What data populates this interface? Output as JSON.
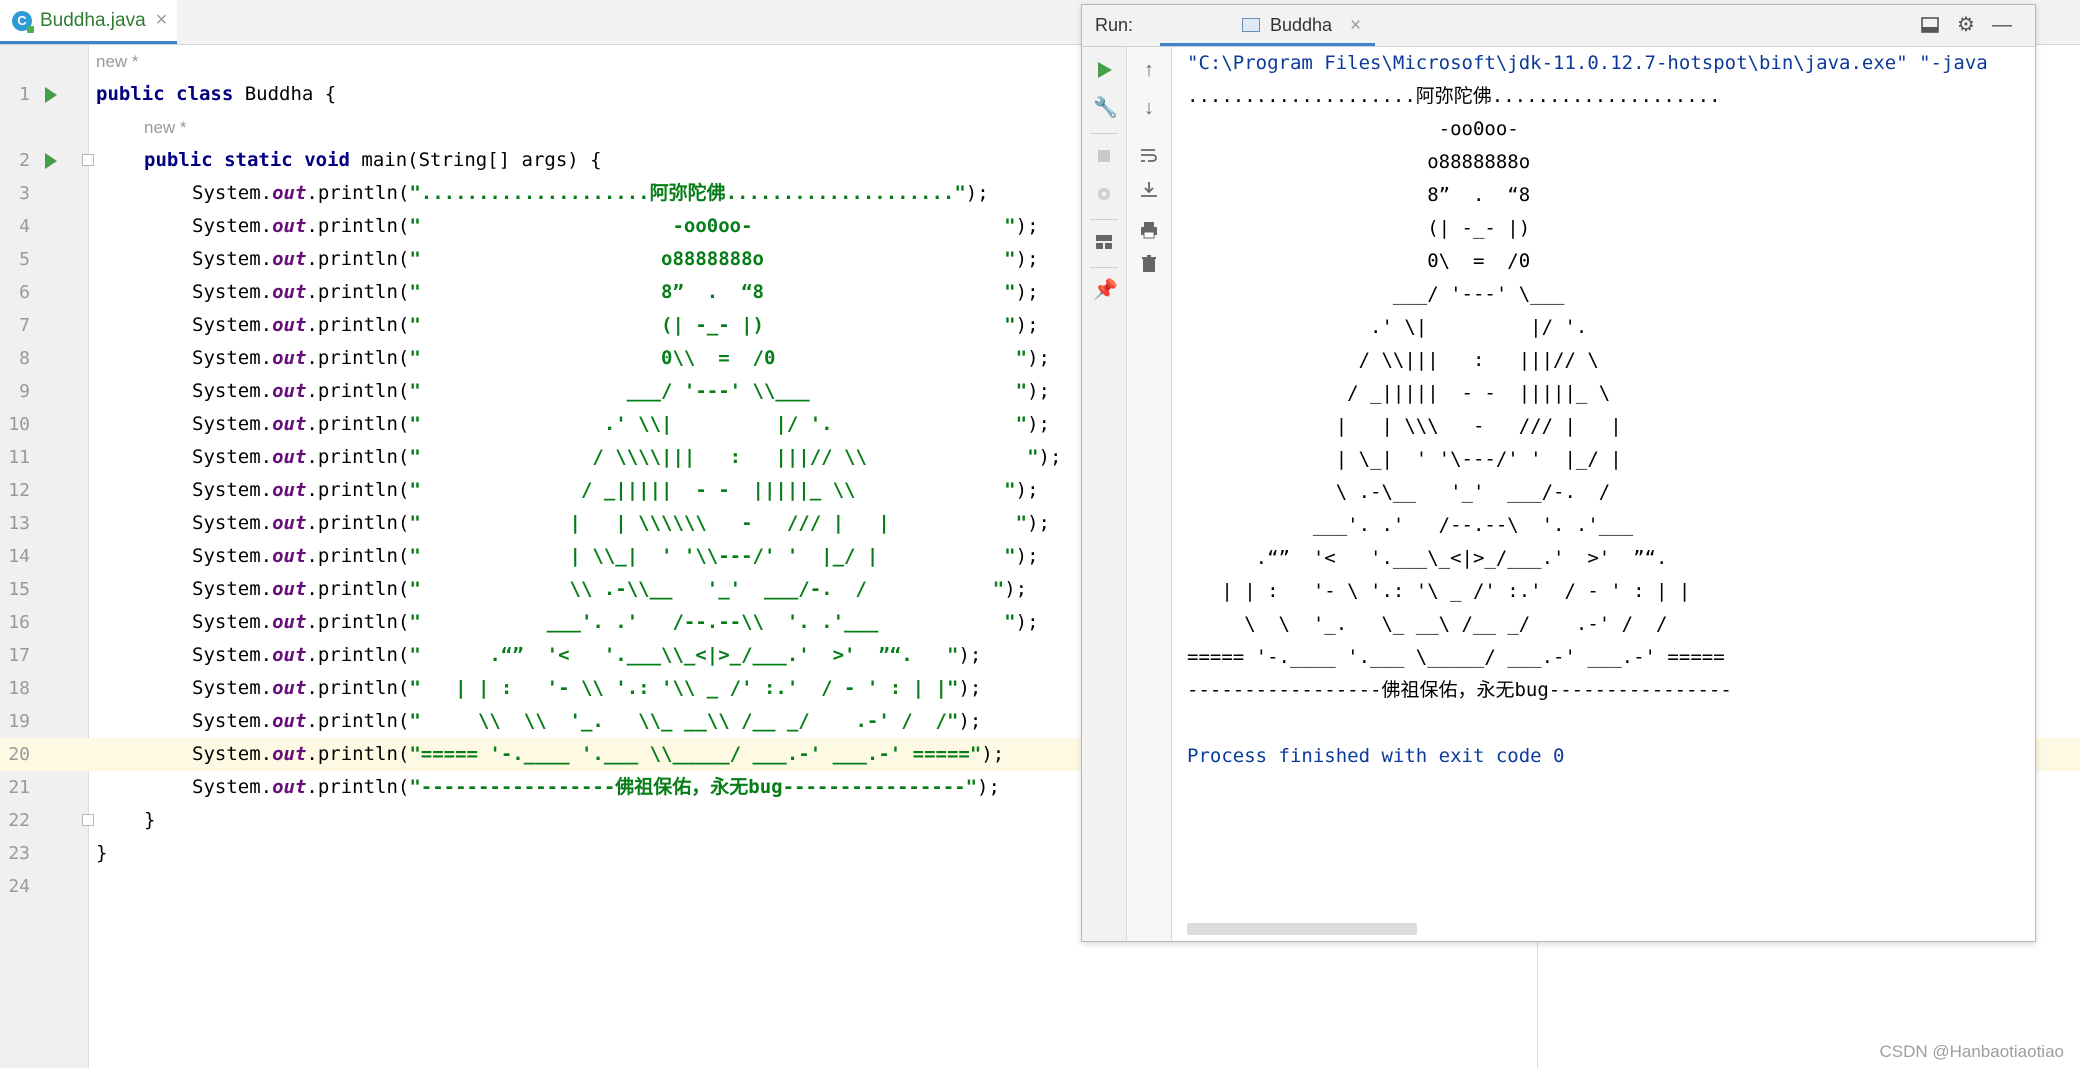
{
  "editor": {
    "tab_title": "Buddha.java",
    "file_icon_letter": "C",
    "tab_close": "×",
    "inlay_hint": "new *",
    "line_numbers": [
      "1",
      "2",
      "3",
      "4",
      "5",
      "6",
      "7",
      "8",
      "9",
      "10",
      "11",
      "12",
      "13",
      "14",
      "15",
      "16",
      "17",
      "18",
      "19",
      "20",
      "21",
      "22",
      "23",
      "24"
    ],
    "code": {
      "line1": [
        "public",
        " ",
        "class",
        " Buddha {"
      ],
      "line2": [
        "public",
        " ",
        "static",
        " ",
        "void",
        " main(String[] args) {"
      ],
      "sys": "System.",
      "out": "out",
      "println": ".println(",
      "end": ");",
      "strings": [
        "\"....................阿弥陀佛....................\"",
        "\"                      -oo0oo-                      \"",
        "\"                     o8888888o                     \"",
        "\"                     8”  .  “8                     \"",
        "\"                     (| -_- |)                     \"",
        "\"                     0\\\\  =  /0                     \"",
        "\"                  ___/ '---' \\\\___                  \"",
        "\"                .' \\\\|         |/ '.                \"",
        "\"               / \\\\\\\\|||   :   |||// \\\\              \"",
        "\"              / _|||||  - -  |||||_ \\\\             \"",
        "\"             |   | \\\\\\\\\\\\   -   /// |   |           \"",
        "\"             | \\\\_|  ' '\\\\---/' '  |_/ |           \"",
        "\"             \\\\ .-\\\\__   '_'  ___/-.  /           \"",
        "\"           ___'. .'   /--.--\\\\  '. .'___           \"",
        "\"      .“”  '<   '.___\\\\_<|>_/___.'  >'  ”“.   \"",
        "\"   | | :   '- \\\\ '.: '\\\\ _ /' :.'  / - ' : | |\"",
        "\"     \\\\  \\\\  '_.   \\\\_ __\\\\ /__ _/    .-' /  /\"",
        "\"===== '-.____ '.___ \\\\_____/ ___.-' ___.-' =====\"",
        "\"-----------------佛祖保佑，永无bug----------------\""
      ],
      "close_method": "}",
      "close_class": "}"
    }
  },
  "run": {
    "title": "Run:",
    "tab_label": "Buddha",
    "tab_close": "×",
    "console": [
      "\"C:\\Program Files\\Microsoft\\jdk-11.0.12.7-hotspot\\bin\\java.exe\" \"-java",
      "....................阿弥陀佛....................",
      "                      -oo0oo-",
      "                     o8888888o",
      "                     8”  .  “8",
      "                     (| -_- |)",
      "                     0\\  =  /0",
      "                  ___/ '---' \\___",
      "                .' \\|         |/ '.",
      "               / \\\\|||   :   |||// \\",
      "              / _|||||  - -  |||||_ \\",
      "             |   | \\\\\\   -   /// |   |",
      "             | \\_|  ' '\\---/' '  |_/ |",
      "             \\ .-\\__   '_'  ___/-.  /",
      "           ___'. .'   /--.--\\  '. .'___",
      "      .“”  '<   '.___\\_<|>_/___.'  >'  ”“.",
      "   | | :   '- \\ '.: '\\ _ /' :.'  / - ' : | |",
      "     \\  \\  '_.   \\_ __\\ /__ _/    .-' /  /",
      "===== '-.____ '.___ \\_____/ ___.-' ___.-' =====",
      "-----------------佛祖保佑，永无bug----------------",
      "",
      "Process finished with exit code 0"
    ]
  },
  "watermark": "CSDN @Hanbaotiaotiao",
  "colors": {
    "keyword": "#000080",
    "string": "#067d17",
    "field": "#660e7a",
    "run_green": "#43a047",
    "tab_accent": "#4083c9"
  }
}
